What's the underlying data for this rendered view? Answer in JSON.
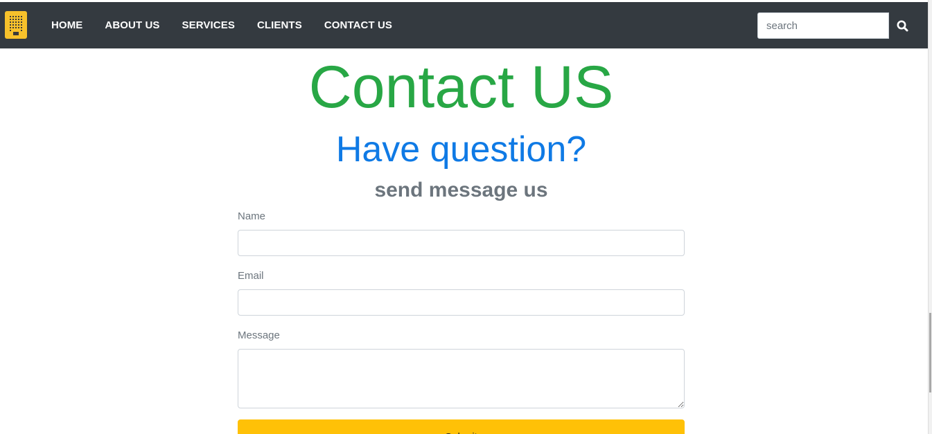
{
  "navbar": {
    "logo_icon": "building-icon",
    "logo_color": "#f7c12b",
    "background": "#343a40",
    "links": [
      {
        "label": "HOME"
      },
      {
        "label": "ABOUT US"
      },
      {
        "label": "SERVICES"
      },
      {
        "label": "CLIENTS"
      },
      {
        "label": "CONTACT US"
      }
    ],
    "search": {
      "placeholder": "search",
      "value": "",
      "button_icon": "search-icon"
    }
  },
  "main": {
    "title": "Contact US",
    "title_color": "#28a745",
    "subtitle": "Have question?",
    "subtitle_color": "#0f7ae5",
    "form_heading": "send message us"
  },
  "form": {
    "name_label": "Name",
    "name_value": "",
    "email_label": "Email",
    "email_value": "",
    "message_label": "Message",
    "message_value": "",
    "submit_label": "Submit",
    "submit_color": "#ffc107"
  }
}
